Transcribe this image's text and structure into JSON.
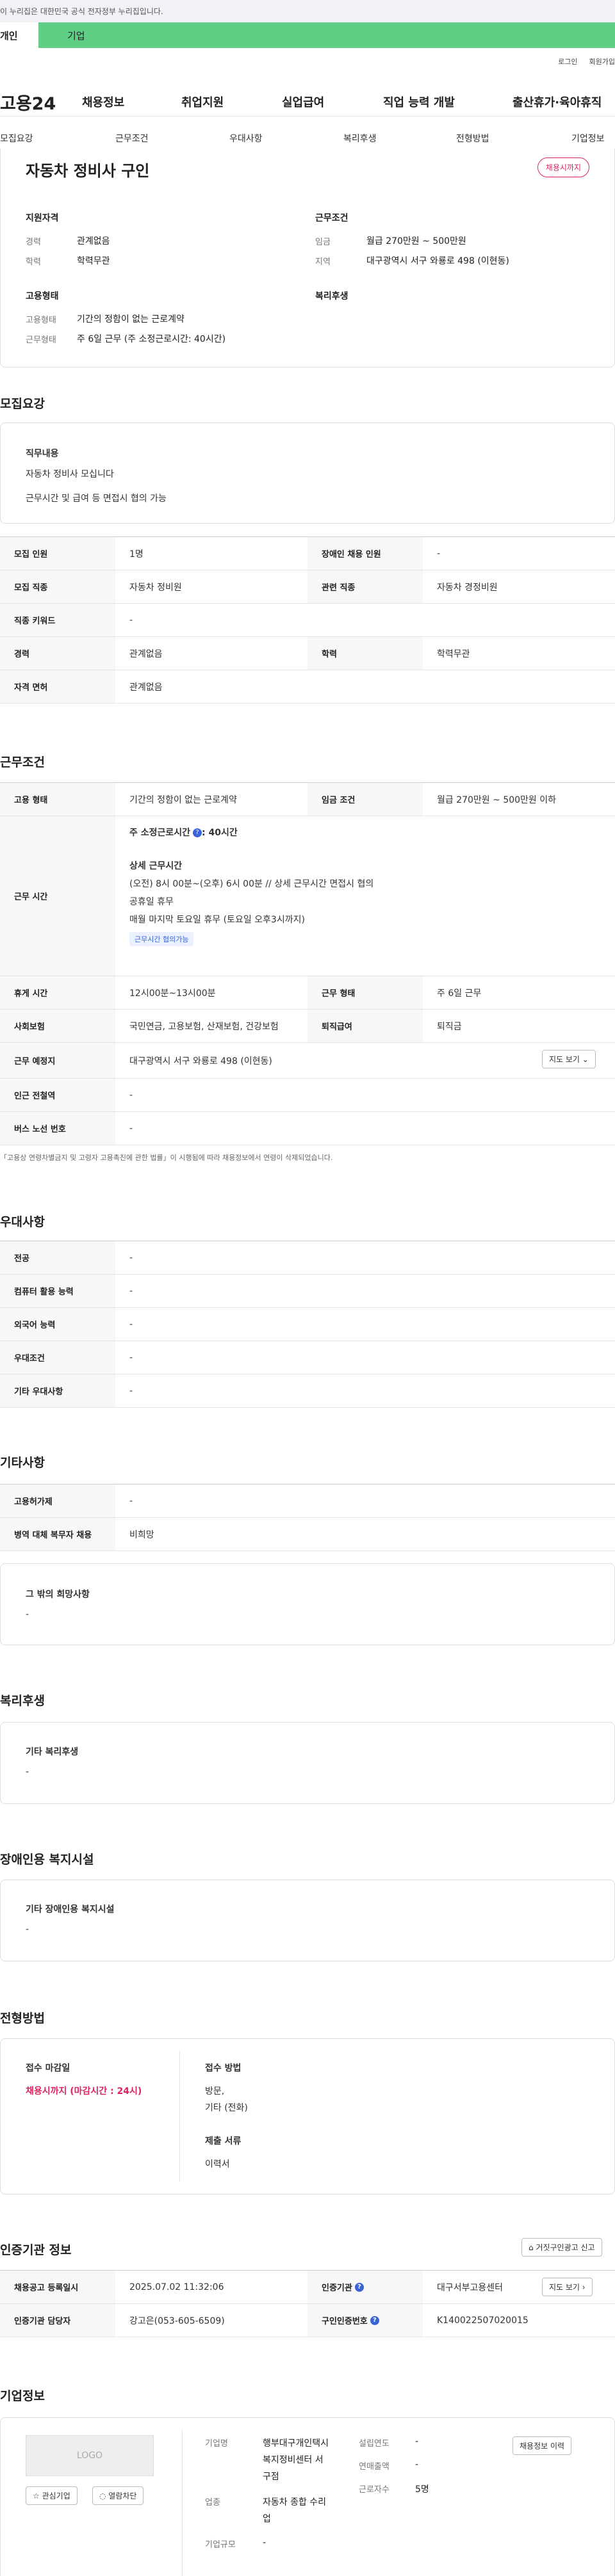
{
  "banner": {
    "text": "이 누리집은 대한민국 공식 전자정부 누리집입니다."
  },
  "top_tabs": {
    "personal": "개인",
    "business": "기업"
  },
  "utility": {
    "login": "로그인",
    "signup": "회원가입"
  },
  "gnb": {
    "logo": "고용24",
    "menu": [
      "채용정보",
      "취업지원",
      "실업급여",
      "직업 능력 개발",
      "출산휴가·육아휴직"
    ]
  },
  "subnav": [
    "모집요강",
    "근무조건",
    "우대사항",
    "복리후생",
    "전형방법",
    "기업정보"
  ],
  "summary": {
    "title": "자동차 정비사 구인",
    "badge": "채용시까지",
    "qualification": {
      "heading": "지원자격",
      "career_k": "경력",
      "career_v": "관계없음",
      "edu_k": "학력",
      "edu_v": "학력무관"
    },
    "conditions": {
      "heading": "근무조건",
      "wage_k": "임금",
      "wage_v": "월급 270만원 ~ 500만원",
      "area_k": "지역",
      "area_v": "대구광역시 서구 와룡로 498 (이현동)"
    },
    "employment": {
      "heading": "고용형태",
      "type_k": "고용형태",
      "type_v": "기간의 정함이 없는 근로계약",
      "form_k": "근무형태",
      "form_v": "주 6일 근무 (주 소정근로시간: 40시간)"
    },
    "welfare": {
      "heading": "복리후생"
    }
  },
  "recruit": {
    "title": "모집요강",
    "duty_heading": "직무내용",
    "duty_line1": "자동차 정비사 모십니다",
    "duty_line2": "근무시간 및 급여 등 면접시 협의 가능",
    "rows": {
      "headcount_k": "모집 인원",
      "headcount_v": "1명",
      "disabled_k": "장애인 채용 인원",
      "disabled_v": "-",
      "job_k": "모집 직종",
      "job_v": "자동차 정비원",
      "related_k": "관련 직종",
      "related_v": "자동차 경정비원",
      "keyword_k": "직종 키워드",
      "keyword_v": "-",
      "career_k": "경력",
      "career_v": "관계없음",
      "edu_k": "학력",
      "edu_v": "학력무관",
      "license_k": "자격 면허",
      "license_v": "관계없음"
    }
  },
  "work": {
    "title": "근무조건",
    "type_k": "고용 형태",
    "type_v": "기간의 정함이 없는 근로계약",
    "wage_k": "임금 조건",
    "wage_v": "월급 270만원 ~ 500만원 이하",
    "hours_k": "근무 시간",
    "hours_weekly": "주 소정근로시간",
    "hours_weekly_v": ": 40시간",
    "hours_detail_h": "상세 근무시간",
    "hours_line1": "(오전) 8시 00분~(오후) 6시 00분 // 상세 근무시간 면접시 협의",
    "hours_line2": "공휴일 휴무",
    "hours_line3": "매월 마지막 토요일 휴무 (토요일 오후3시까지)",
    "hours_chip": "근무시간 협의가능",
    "break_k": "휴게 시간",
    "break_v": "12시00분~13시00분",
    "form_k": "근무 형태",
    "form_v": "주 6일 근무",
    "insurance_k": "사회보험",
    "insurance_v": "국민연금, 고용보험, 산재보험, 건강보험",
    "retire_k": "퇴직급여",
    "retire_v": "퇴직금",
    "place_k": "근무 예정지",
    "place_v": "대구광역시 서구 와룡로 498 (이현동)",
    "map_btn": "지도 보기 ⌄",
    "subway_k": "인근 전철역",
    "subway_v": "-",
    "bus_k": "버스 노선 번호",
    "bus_v": "-",
    "note": "「고용상 연령차별금지 및 고령자 고용촉진에 관한 법률」이 시행됨에 따라 채용정보에서 연령이 삭제되었습니다."
  },
  "prefer": {
    "title": "우대사항",
    "major_k": "전공",
    "major_v": "-",
    "computer_k": "컴퓨터 활용 능력",
    "computer_v": "-",
    "language_k": "외국어 능력",
    "language_v": "-",
    "cond_k": "우대조건",
    "cond_v": "-",
    "etc_k": "기타 우대사항",
    "etc_v": "-"
  },
  "other": {
    "title": "기타사항",
    "support_k": "고용허가제",
    "support_v": "-",
    "military_k": "병역 대체 복무자 채용",
    "military_v": "비희망",
    "wish_h": "그 밖의 희망사항",
    "wish_v": "-"
  },
  "welfare": {
    "title": "복리후생",
    "etc_h": "기타 복리후생",
    "etc_v": "-"
  },
  "disabled_fac": {
    "title": "장애인용 복지시설",
    "etc_h": "기타 장애인용 복지시설",
    "etc_v": "-"
  },
  "selection": {
    "title": "전형방법",
    "deadline_h": "접수 마감일",
    "deadline_v": "채용시까지 (마감시간 : 24시)",
    "method_h": "접수 방법",
    "method_v1": "방문,",
    "method_v2": "기타 (전화)",
    "docs_h": "제출 서류",
    "docs_v": "이력서"
  },
  "agency": {
    "title": "인증기관 정보",
    "report_btn": "거짓구인광고 신고",
    "reg_k": "채용공고 등록일시",
    "reg_v": "2025.07.02 11:32:06",
    "org_k": "인증기관",
    "org_v": "대구서부고용센터",
    "map_btn": "지도 보기 ›",
    "staff_k": "인증기관 담당자",
    "staff_v": "강고은(053-605-6509)",
    "no_k": "구인인증번호",
    "no_v": "K140022507020015"
  },
  "company": {
    "title": "기업정보",
    "logo": "LOGO",
    "fav_btn": "☆ 관심기업",
    "block_btn": "◌ 열람차단",
    "name_k": "기업명",
    "name_v1": "행부대구개인택시",
    "name_v2": "복지정비센터 서",
    "name_v3": "구점",
    "industry_k": "업종",
    "industry_v1": "자동차 종합 수리",
    "industry_v2": "업",
    "size_k": "기업규모",
    "size_v": "-",
    "year_k": "설립연도",
    "year_v": "-",
    "sales_k": "연매출액",
    "sales_v": "-",
    "workers_k": "근로자수",
    "workers_v": "5명",
    "more_btn": "채용정보 이력"
  },
  "colors": {
    "accent_green": "#5fcf86",
    "badge_red": "#e0245e",
    "info_blue": "#3a63d8"
  }
}
